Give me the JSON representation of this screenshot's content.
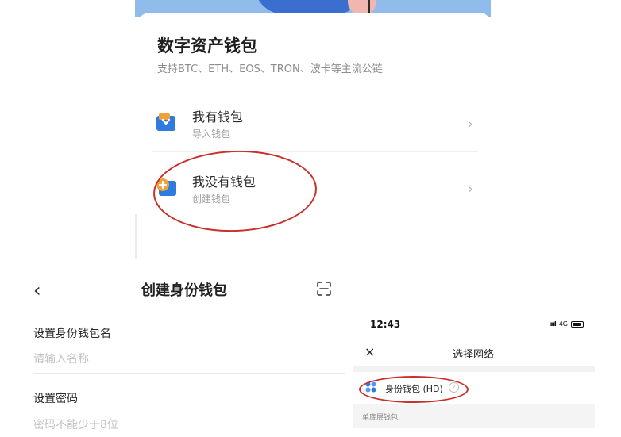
{
  "wallet_intro": {
    "title": "数字资产钱包",
    "subtitle": "支持BTC、ETH、EOS、TRON、波卡等主流公链",
    "options": [
      {
        "label": "我有钱包",
        "sub": "导入钱包",
        "icon": "import-wallet-icon"
      },
      {
        "label": "我没有钱包",
        "sub": "创建钱包",
        "icon": "create-wallet-icon"
      }
    ],
    "chevron": "›"
  },
  "create_wallet": {
    "back": "‹",
    "title": "创建身份钱包",
    "name_label": "设置身份钱包名",
    "name_placeholder": "请输入名称",
    "password_label": "设置密码",
    "password_placeholder": "密码不能少于8位"
  },
  "select_network": {
    "time": "12:43",
    "network_type": "4G",
    "close": "×",
    "title": "选择网络",
    "hd_label": "身份钱包 (HD)",
    "help": "?",
    "section_label": "单底层钱包"
  },
  "colors": {
    "highlight_circle": "#c9302c",
    "wallet_blue": "#2f7be0",
    "wallet_orange": "#f0a23a"
  }
}
